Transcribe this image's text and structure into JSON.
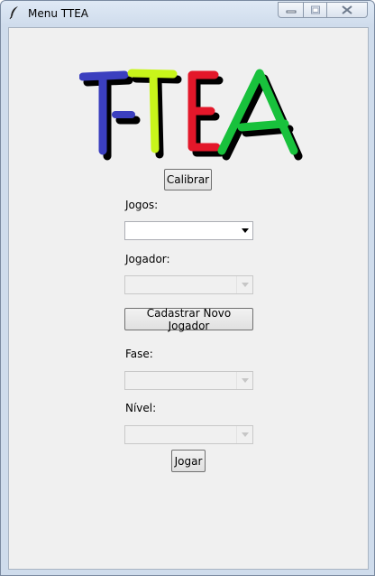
{
  "window": {
    "title": "Menu TTEA"
  },
  "logo": {
    "text": "T-TEA",
    "colors": [
      "#3b3fbf",
      "#c8f51a",
      "#e3172a",
      "#e3172a",
      "#18c13c"
    ]
  },
  "buttons": {
    "calibrar": "Calibrar",
    "cadastrar": "Cadastrar Novo Jogador",
    "jogar": "Jogar"
  },
  "fields": {
    "jogos": {
      "label": "Jogos:",
      "value": "",
      "enabled": true
    },
    "jogador": {
      "label": "Jogador:",
      "value": "",
      "enabled": false
    },
    "fase": {
      "label": "Fase:",
      "value": "",
      "enabled": false
    },
    "nivel": {
      "label": "Nível:",
      "value": "",
      "enabled": false
    }
  },
  "icons": {
    "app": "feather-icon",
    "minimize": "minimize-icon",
    "maximize": "maximize-icon",
    "close": "close-icon",
    "dropdown": "dropdown-arrow-icon"
  }
}
